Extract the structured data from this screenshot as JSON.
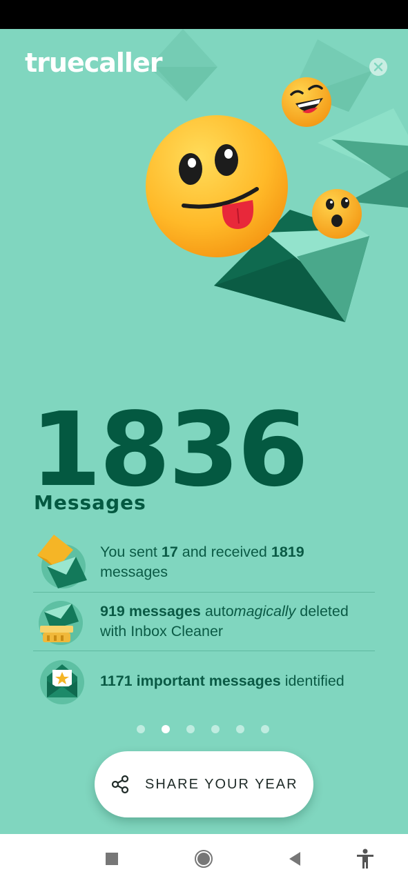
{
  "brand": {
    "logo_text": "truecaller"
  },
  "summary": {
    "count": "1836",
    "label": "Messages"
  },
  "stats": [
    {
      "icon": "envelopes-icon",
      "t1": "You sent ",
      "b1": "17",
      "t2": " and received ",
      "b2": "1819",
      "t3": " messages"
    },
    {
      "icon": "inbox-cleaner-icon",
      "b1": "919 messages",
      "t1": " auto",
      "i1": "magically",
      "t2": " deleted with Inbox Cleaner"
    },
    {
      "icon": "important-envelope-icon",
      "b1": "1171 important messages",
      "t1": " identified"
    }
  ],
  "pagination": {
    "total": 6,
    "active_index": 1
  },
  "share": {
    "label": "SHARE YOUR YEAR",
    "icon": "share-icon"
  },
  "colors": {
    "background": "#80d6bf",
    "dark_green": "#045941",
    "text_green": "#0a5a45",
    "emoji_yellow": "#ffb928",
    "white": "#ffffff"
  },
  "nav": {
    "icons": [
      "recents-icon",
      "home-icon",
      "back-icon",
      "accessibility-icon"
    ]
  }
}
